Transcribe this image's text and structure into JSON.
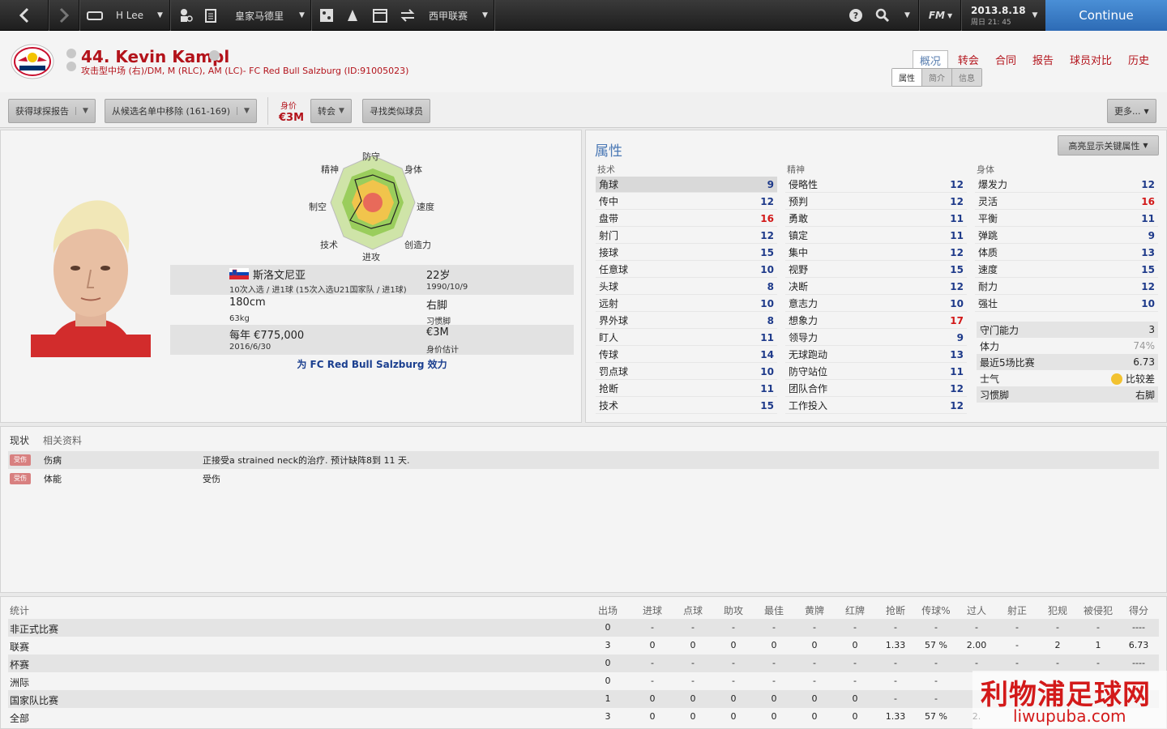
{
  "topbar": {
    "manager": "H Lee",
    "club": "皇家马德里",
    "competition": "西甲联赛",
    "fm": "FM",
    "date": "2013.8.18",
    "time": "周日 21: 45",
    "continue": "Continue"
  },
  "player": {
    "name": "44. Kevin Kampl",
    "positions": "攻击型中场 (右)/DM, M (RLC), AM (LC)- FC Red Bull Salzburg (ID:91005023)",
    "tabs": [
      "概况",
      "转会",
      "合同",
      "报告",
      "球员对比",
      "历史"
    ],
    "subtabs": [
      "属性",
      "简介",
      "信息"
    ]
  },
  "toolbar": {
    "scout": "获得球探报告",
    "remove": "从候选名单中移除 (161-169)",
    "value_label": "身价",
    "value": "€3M",
    "transfer": "转会",
    "similar": "寻找类似球员",
    "more": "更多..."
  },
  "radar": {
    "labels": [
      "防守",
      "身体",
      "速度",
      "创造力",
      "进攻",
      "技术",
      "制空",
      "精神"
    ]
  },
  "info": {
    "nation": "斯洛文尼亚",
    "caps": "10次入选 / 进1球 (15次入选U21国家队 / 进1球)",
    "age": "22岁",
    "dob": "1990/10/9",
    "height": "180cm",
    "weight": "63kg",
    "foot": "右脚",
    "foot_label": "习惯脚",
    "wage": "每年 €775,000",
    "contract": "2016/6/30",
    "value": "€3M",
    "value_label": "身价估计",
    "plays_for": "为 FC Red Bull Salzburg 效力"
  },
  "attributes": {
    "title": "属性",
    "highlight_btn": "高亮显示关键属性",
    "technical_title": "技术",
    "mental_title": "精神",
    "physical_title": "身体",
    "technical": [
      {
        "n": "角球",
        "v": "9"
      },
      {
        "n": "传中",
        "v": "12"
      },
      {
        "n": "盘带",
        "v": "16"
      },
      {
        "n": "射门",
        "v": "12"
      },
      {
        "n": "接球",
        "v": "15"
      },
      {
        "n": "任意球",
        "v": "10"
      },
      {
        "n": "头球",
        "v": "8"
      },
      {
        "n": "远射",
        "v": "10"
      },
      {
        "n": "界外球",
        "v": "8"
      },
      {
        "n": "盯人",
        "v": "11"
      },
      {
        "n": "传球",
        "v": "14"
      },
      {
        "n": "罚点球",
        "v": "10"
      },
      {
        "n": "抢断",
        "v": "11"
      },
      {
        "n": "技术",
        "v": "15"
      }
    ],
    "mental": [
      {
        "n": "侵略性",
        "v": "12"
      },
      {
        "n": "预判",
        "v": "12"
      },
      {
        "n": "勇敢",
        "v": "11"
      },
      {
        "n": "镇定",
        "v": "11"
      },
      {
        "n": "集中",
        "v": "12"
      },
      {
        "n": "视野",
        "v": "15"
      },
      {
        "n": "决断",
        "v": "12"
      },
      {
        "n": "意志力",
        "v": "10"
      },
      {
        "n": "想象力",
        "v": "17"
      },
      {
        "n": "领导力",
        "v": "9"
      },
      {
        "n": "无球跑动",
        "v": "13"
      },
      {
        "n": "防守站位",
        "v": "11"
      },
      {
        "n": "团队合作",
        "v": "12"
      },
      {
        "n": "工作投入",
        "v": "12"
      }
    ],
    "physical": [
      {
        "n": "爆发力",
        "v": "12"
      },
      {
        "n": "灵活",
        "v": "16"
      },
      {
        "n": "平衡",
        "v": "11"
      },
      {
        "n": "弹跳",
        "v": "9"
      },
      {
        "n": "体质",
        "v": "13"
      },
      {
        "n": "速度",
        "v": "15"
      },
      {
        "n": "耐力",
        "v": "12"
      },
      {
        "n": "强壮",
        "v": "10"
      }
    ],
    "summary": [
      {
        "n": "守门能力",
        "v": "3"
      },
      {
        "n": "体力",
        "v": "74%"
      },
      {
        "n": "最近5场比赛",
        "v": "6.73"
      },
      {
        "n": "士气",
        "v": "比较差"
      },
      {
        "n": "习惯脚",
        "v": "右脚"
      }
    ]
  },
  "status": {
    "tab1": "现状",
    "tab2": "相关资料",
    "badge": "受伤",
    "rows": [
      {
        "label": "伤病",
        "value": "正接受a strained neck的治疗. 预计缺阵8到 11 天."
      },
      {
        "label": "体能",
        "value": "受伤"
      }
    ]
  },
  "stats": {
    "title": "统计",
    "cols": [
      "出场",
      "进球",
      "点球",
      "助攻",
      "最佳",
      "黄牌",
      "红牌",
      "抢断",
      "传球%",
      "过人",
      "射正",
      "犯规",
      "被侵犯",
      "得分"
    ],
    "rows": [
      {
        "name": "非正式比赛",
        "vals": [
          "0",
          "-",
          "-",
          "-",
          "-",
          "-",
          "-",
          "-",
          "-",
          "-",
          "-",
          "-",
          "-",
          "----"
        ]
      },
      {
        "name": "联赛",
        "vals": [
          "3",
          "0",
          "0",
          "0",
          "0",
          "0",
          "0",
          "1.33",
          "57 %",
          "2.00",
          "-",
          "2",
          "1",
          "6.73"
        ]
      },
      {
        "name": "杯赛",
        "vals": [
          "0",
          "-",
          "-",
          "-",
          "-",
          "-",
          "-",
          "-",
          "-",
          "-",
          "-",
          "-",
          "-",
          "----"
        ]
      },
      {
        "name": "洲际",
        "vals": [
          "0",
          "-",
          "-",
          "-",
          "-",
          "-",
          "-",
          "-",
          "-",
          "",
          "",
          "",
          "",
          ""
        ]
      },
      {
        "name": "国家队比赛",
        "vals": [
          "1",
          "0",
          "0",
          "0",
          "0",
          "0",
          "0",
          "-",
          "-",
          "",
          "",
          "",
          "",
          ""
        ]
      },
      {
        "name": "全部",
        "vals": [
          "3",
          "0",
          "0",
          "0",
          "0",
          "0",
          "0",
          "1.33",
          "57 %",
          "2.",
          "",
          "",
          "",
          ""
        ]
      }
    ]
  },
  "watermark": {
    "line1": "利物浦足球网",
    "line2": "liwupuba.com"
  }
}
